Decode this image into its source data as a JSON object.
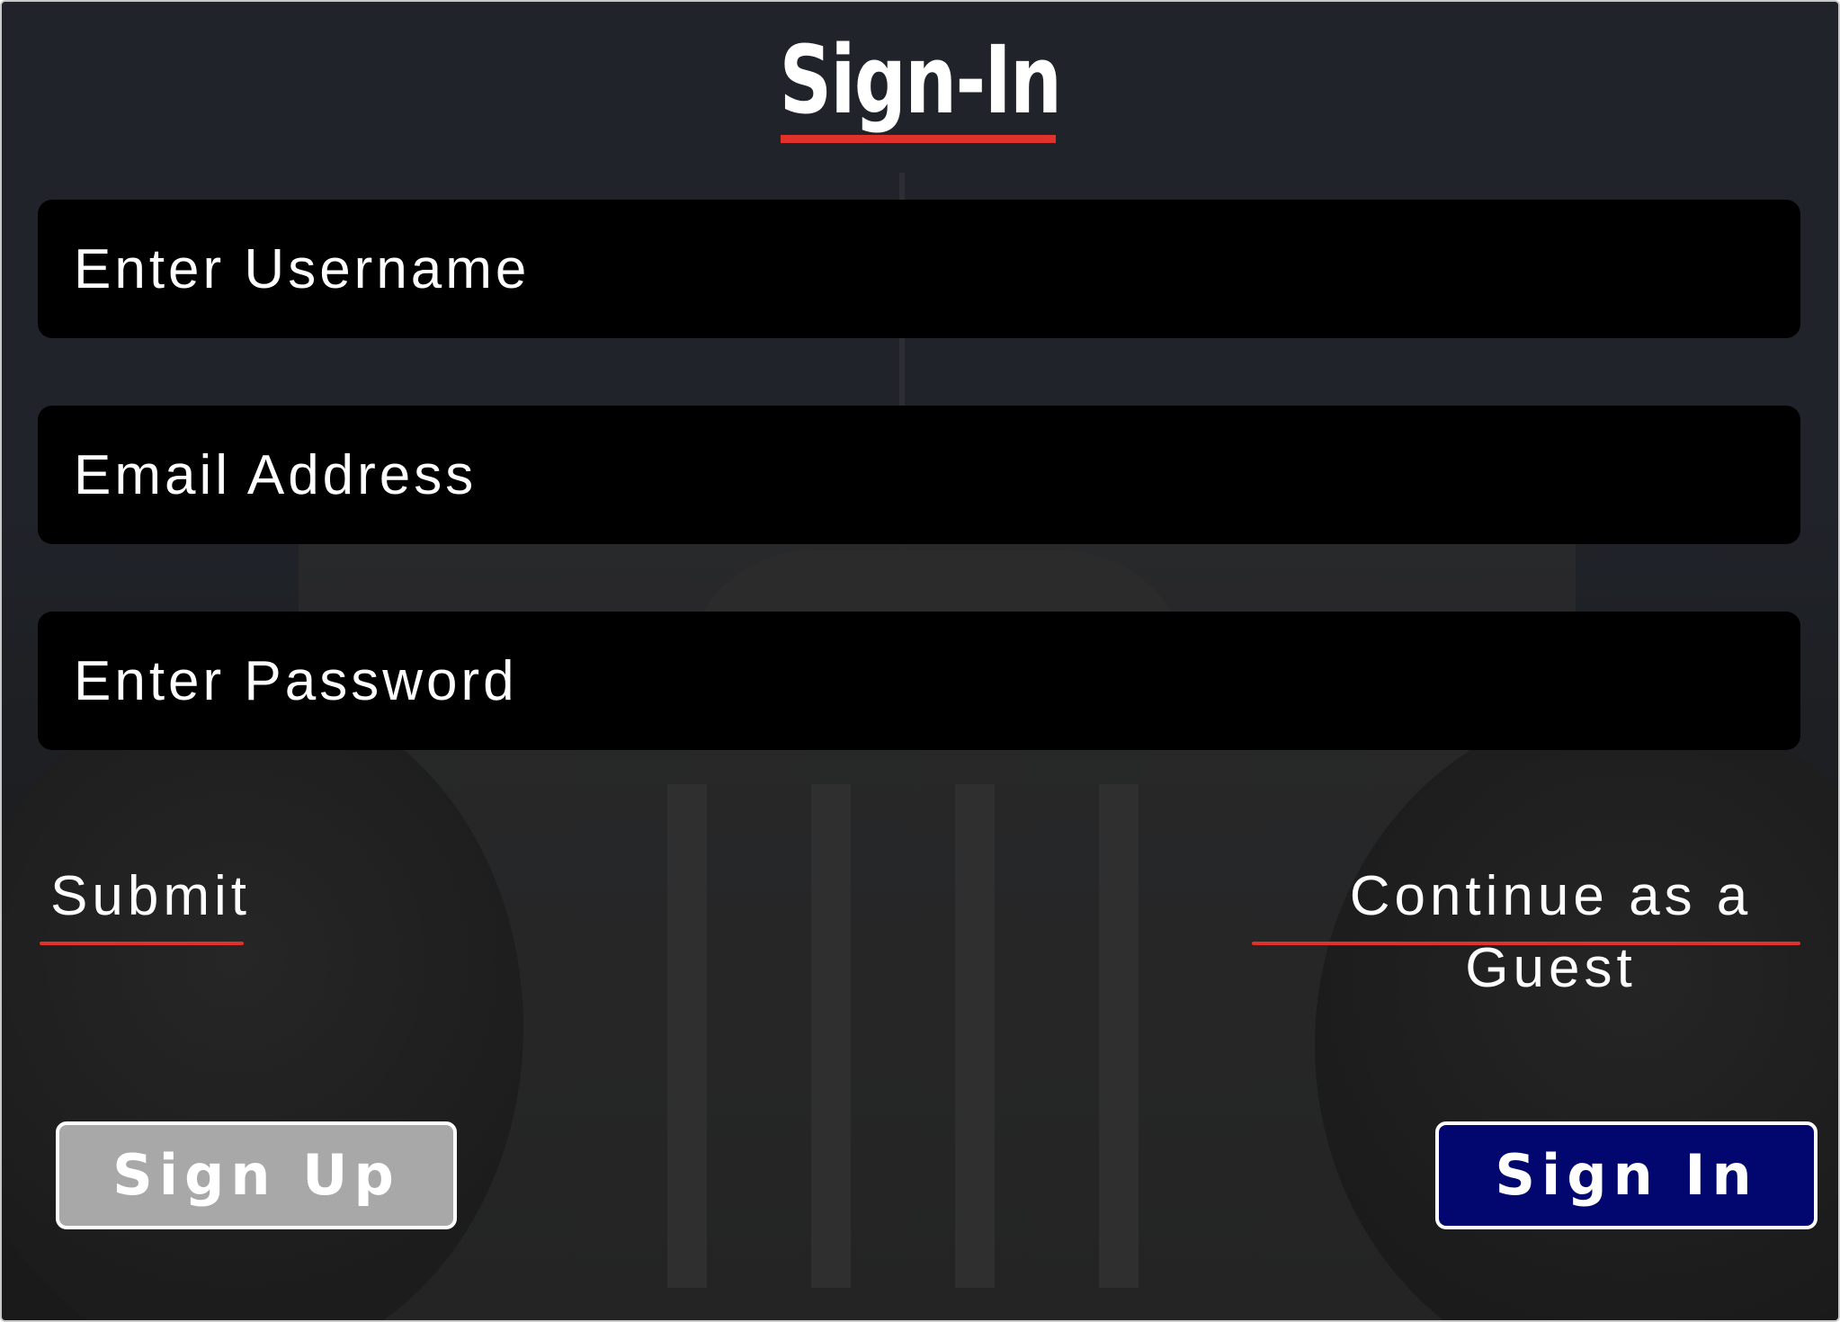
{
  "header": {
    "title": "Sign-In"
  },
  "form": {
    "username_placeholder": "Enter Username",
    "email_placeholder": "Email Address",
    "password_placeholder": "Enter Password",
    "submit_label": "Submit",
    "guest_label": "Continue as a Guest"
  },
  "footer": {
    "signup_label": "Sign Up",
    "signin_label": "Sign In"
  },
  "colors": {
    "accent_underline": "#e0322a",
    "signin_button": "#02066f",
    "signup_button": "#a8a8a8",
    "field_background": "#000000",
    "panel_background": "#1e2026"
  }
}
